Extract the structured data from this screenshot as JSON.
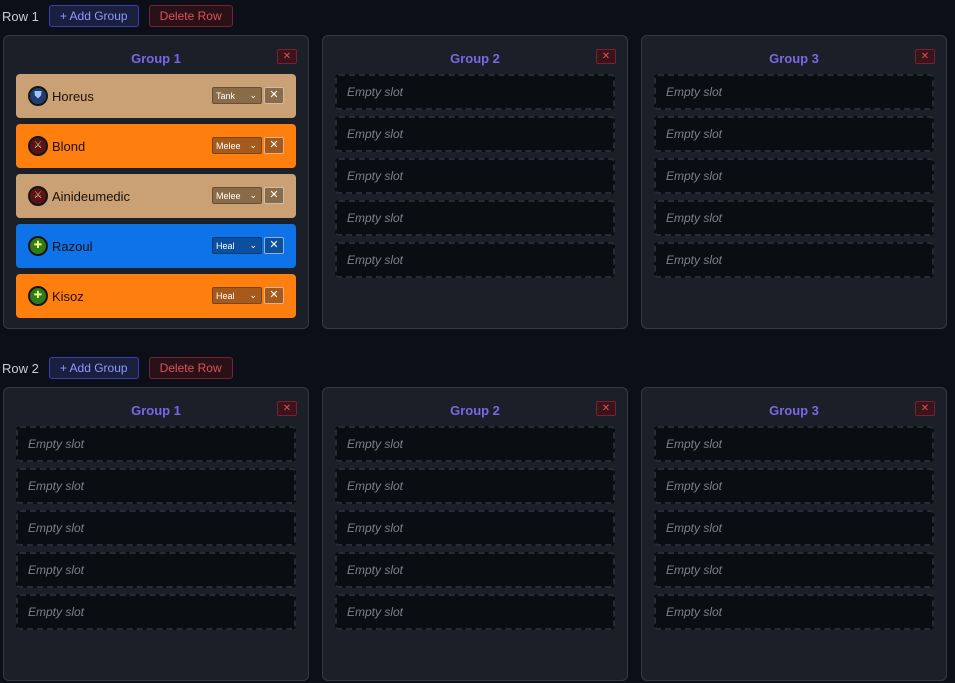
{
  "rows": [
    {
      "label": "Row 1",
      "add_label": "+ Add Group",
      "delete_label": "Delete Row",
      "groups": [
        {
          "title": "Group 1",
          "close": "✕",
          "players": [
            {
              "name": "Horeus",
              "role": "Tank",
              "bg": "#c9a175",
              "role_bg": "#8a6b47",
              "icon_bg": "#1f3e6e",
              "icon": "shield-icon",
              "icon_glyph": "⛊",
              "icon_color": "#9fc3ff"
            },
            {
              "name": "Blond",
              "role": "Melee",
              "bg": "#ff7f0e",
              "role_bg": "#a55a1c",
              "icon_bg": "#5a1414",
              "icon": "sword-icon",
              "icon_glyph": "⚔",
              "icon_color": "#e5c28a"
            },
            {
              "name": "Ainideumedic",
              "role": "Melee",
              "bg": "#c9a175",
              "role_bg": "#8a6b47",
              "icon_bg": "#5a1414",
              "icon": "sword-icon",
              "icon_glyph": "⚔",
              "icon_color": "#e5c28a"
            },
            {
              "name": "Razoul",
              "role": "Heal",
              "bg": "#0e72e8",
              "role_bg": "#0b4f9e",
              "icon_bg": "#2f7a19",
              "icon": "heal-cross-icon",
              "icon_glyph": "✚",
              "icon_color": "#e6ff7a"
            },
            {
              "name": "Kisoz",
              "role": "Heal",
              "bg": "#ff7f0e",
              "role_bg": "#a55a1c",
              "icon_bg": "#2f7a19",
              "icon": "heal-cross-icon",
              "icon_glyph": "✚",
              "icon_color": "#e6ff7a"
            }
          ],
          "empty_slots": []
        },
        {
          "title": "Group 2",
          "close": "✕",
          "players": [],
          "empty_slots": [
            "Empty slot",
            "Empty slot",
            "Empty slot",
            "Empty slot",
            "Empty slot"
          ]
        },
        {
          "title": "Group 3",
          "close": "✕",
          "players": [],
          "empty_slots": [
            "Empty slot",
            "Empty slot",
            "Empty slot",
            "Empty slot",
            "Empty slot"
          ]
        }
      ]
    },
    {
      "label": "Row 2",
      "add_label": "+ Add Group",
      "delete_label": "Delete Row",
      "groups": [
        {
          "title": "Group 1",
          "close": "✕",
          "players": [],
          "empty_slots": [
            "Empty slot",
            "Empty slot",
            "Empty slot",
            "Empty slot",
            "Empty slot"
          ]
        },
        {
          "title": "Group 2",
          "close": "✕",
          "players": [],
          "empty_slots": [
            "Empty slot",
            "Empty slot",
            "Empty slot",
            "Empty slot",
            "Empty slot"
          ]
        },
        {
          "title": "Group 3",
          "close": "✕",
          "players": [],
          "empty_slots": [
            "Empty slot",
            "Empty slot",
            "Empty slot",
            "Empty slot",
            "Empty slot"
          ]
        }
      ]
    }
  ],
  "remove_player_glyph": "✕",
  "dropdown_glyph": "⌄"
}
